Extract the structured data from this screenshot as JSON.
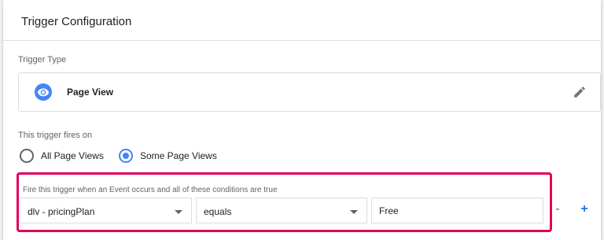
{
  "card": {
    "title": "Trigger Configuration"
  },
  "trigger_type": {
    "label": "Trigger Type",
    "name": "Page View",
    "icon": "eye-icon",
    "edit_icon": "pencil-icon",
    "icon_color": "#4285f4"
  },
  "fires_on": {
    "label": "This trigger fires on",
    "options": [
      {
        "label": "All Page Views",
        "checked": false
      },
      {
        "label": "Some Page Views",
        "checked": true
      }
    ]
  },
  "conditions": {
    "label": "Fire this trigger when an Event occurs and all of these conditions are true",
    "variable": "dlv - pricingPlan",
    "operator": "equals",
    "value": "Free",
    "remove_label": "-",
    "add_label": "+",
    "highlight_color": "#e0005a",
    "accent_color": "#1a73e8"
  }
}
